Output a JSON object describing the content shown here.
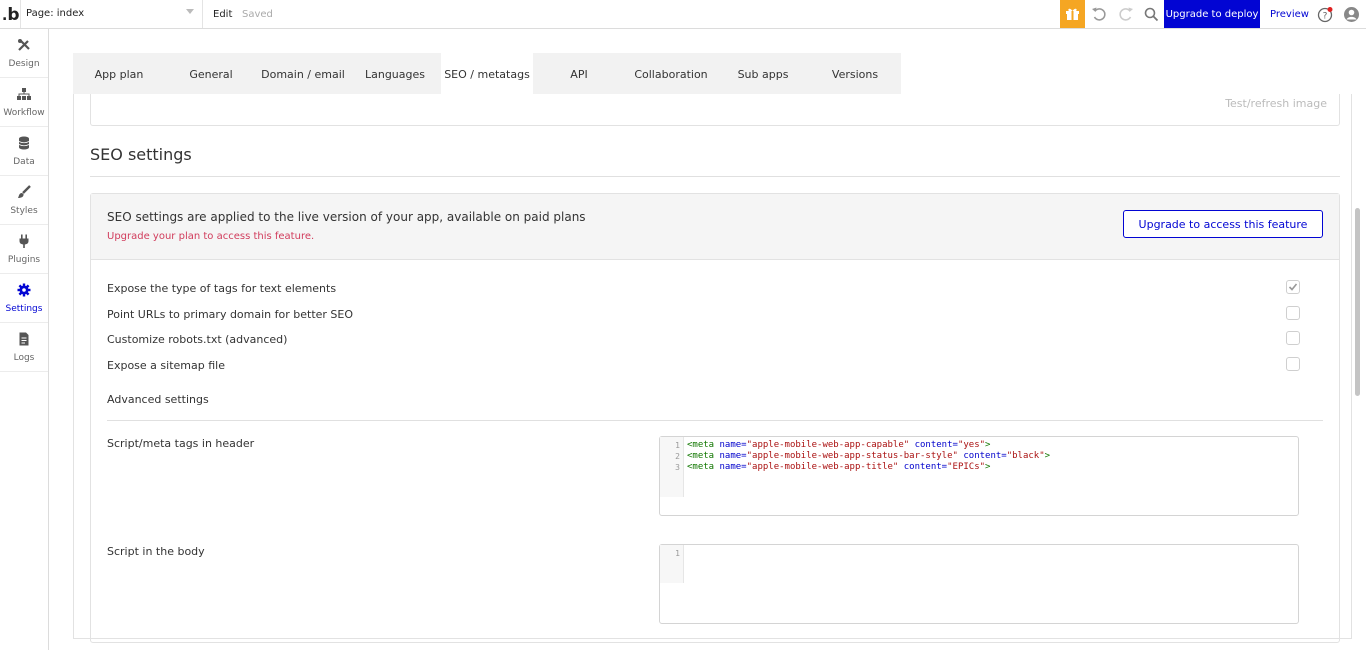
{
  "topbar": {
    "logo": "b",
    "page_select": "Page: index",
    "edit_label": "Edit",
    "saved_label": "Saved",
    "upgrade_deploy_label": "Upgrade to deploy",
    "preview_label": "Preview",
    "icons": [
      "gift-icon",
      "undo-icon",
      "redo-icon",
      "search-icon",
      "help-icon",
      "user-icon"
    ]
  },
  "sidebar": {
    "items": [
      {
        "label": "Design",
        "icon": "design-icon"
      },
      {
        "label": "Workflow",
        "icon": "workflow-icon"
      },
      {
        "label": "Data",
        "icon": "database-icon"
      },
      {
        "label": "Styles",
        "icon": "brush-icon"
      },
      {
        "label": "Plugins",
        "icon": "plug-icon"
      },
      {
        "label": "Settings",
        "icon": "gear-icon",
        "active": true
      },
      {
        "label": "Logs",
        "icon": "document-icon"
      }
    ]
  },
  "tabs": [
    {
      "label": "App plan"
    },
    {
      "label": "General"
    },
    {
      "label": "Domain / email"
    },
    {
      "label": "Languages"
    },
    {
      "label": "SEO / metatags",
      "active": true
    },
    {
      "label": "API"
    },
    {
      "label": "Collaboration"
    },
    {
      "label": "Sub apps"
    },
    {
      "label": "Versions"
    }
  ],
  "image_section": {
    "test_refresh_label": "Test/refresh image"
  },
  "seo": {
    "title": "SEO settings",
    "notice_main": "SEO settings are applied to the live version of your app, available on paid plans",
    "notice_sub": "Upgrade your plan to access this feature.",
    "upgrade_button": "Upgrade to access this feature",
    "options": [
      {
        "label": "Expose the type of tags for text elements",
        "checked": true
      },
      {
        "label": "Point URLs to primary domain for better SEO",
        "checked": false
      },
      {
        "label": "Customize robots.txt (advanced)",
        "checked": false
      },
      {
        "label": "Expose a sitemap file",
        "checked": false
      }
    ],
    "advanced_label": "Advanced settings",
    "header_script_label": "Script/meta tags in header",
    "header_script_lines": [
      {
        "n": "1",
        "tag_open": "<meta",
        "a1": " name=",
        "v1": "\"apple-mobile-web-app-capable\"",
        "a2": " content=",
        "v2": "\"yes\"",
        "tag_close": ">"
      },
      {
        "n": "2",
        "tag_open": "<meta",
        "a1": " name=",
        "v1": "\"apple-mobile-web-app-status-bar-style\"",
        "a2": " content=",
        "v2": "\"black\"",
        "tag_close": ">"
      },
      {
        "n": "3",
        "tag_open": "<meta",
        "a1": " name=",
        "v1": "\"apple-mobile-web-app-title\"",
        "a2": " content=",
        "v2": "\"EPICs\"",
        "tag_close": ">"
      }
    ],
    "body_script_label": "Script in the body",
    "body_script_lines": [
      {
        "n": "1"
      }
    ]
  },
  "colors": {
    "accent": "#0205d3",
    "warning": "#d13c5c",
    "gift": "#f5a623"
  }
}
